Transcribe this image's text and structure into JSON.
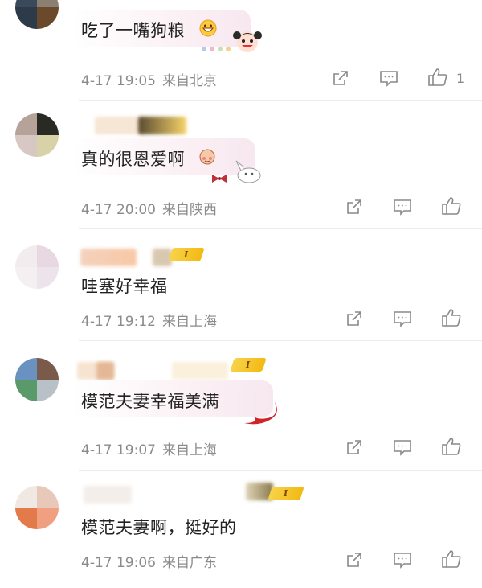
{
  "comments": [
    {
      "text": "吃了一嘴狗粮",
      "date": "4-17 19:05",
      "location": "来自北京",
      "like_count": "1"
    },
    {
      "text": "真的很恩爱啊",
      "date": "4-17 20:00",
      "location": "来自陕西",
      "like_count": ""
    },
    {
      "text": "哇塞好幸福",
      "date": "4-17 19:12",
      "location": "来自上海",
      "like_count": "",
      "level": "I"
    },
    {
      "text": "模范夫妻幸福美满",
      "date": "4-17 19:07",
      "location": "来自上海",
      "like_count": "",
      "level": "I"
    },
    {
      "text": "模范夫妻啊，挺好的",
      "date": "4-17 19:06",
      "location": "来自广东",
      "like_count": "",
      "level": "I"
    }
  ],
  "icons": {
    "share": "share-icon",
    "reply": "comment-icon",
    "like": "thumbs-up-icon"
  },
  "colors": {
    "text": "#222222",
    "meta": "#8b8b8b",
    "icon": "#888888",
    "badge": "#f3c32a"
  }
}
